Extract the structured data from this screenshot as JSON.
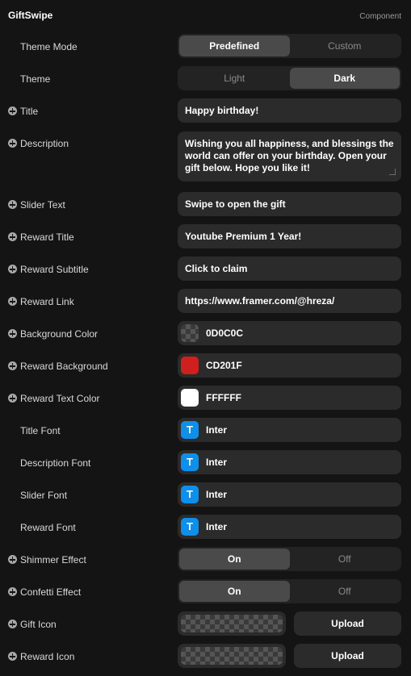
{
  "header": {
    "title": "GiftSwipe",
    "kind": "Component"
  },
  "theme_mode": {
    "label": "Theme Mode",
    "options": [
      "Predefined",
      "Custom"
    ],
    "selected": "Predefined"
  },
  "theme": {
    "label": "Theme",
    "options": [
      "Light",
      "Dark"
    ],
    "selected": "Dark"
  },
  "title": {
    "label": "Title",
    "value": "Happy birthday!"
  },
  "description": {
    "label": "Description",
    "lines": [
      "Wishing you all happiness, and blessings the",
      "world can offer on your birthday. Open your",
      "gift below. Hope you like it!"
    ]
  },
  "slider_text": {
    "label": "Slider Text",
    "value": "Swipe to open the gift"
  },
  "reward_title": {
    "label": "Reward Title",
    "value": "Youtube Premium 1 Year!"
  },
  "reward_subtitle": {
    "label": "Reward Subtitle",
    "value": "Click to claim"
  },
  "reward_link": {
    "label": "Reward Link",
    "value": "https://www.framer.com/@hreza/"
  },
  "background_color": {
    "label": "Background Color",
    "value": "0D0C0C",
    "color": "#0D0C0C"
  },
  "reward_background": {
    "label": "Reward Background",
    "value": "CD201F",
    "color": "#CD201F"
  },
  "reward_text_color": {
    "label": "Reward Text Color",
    "value": "FFFFFF",
    "color": "#FFFFFF"
  },
  "title_font": {
    "label": "Title Font",
    "icon": "T",
    "value": "Inter"
  },
  "description_font": {
    "label": "Description Font",
    "icon": "T",
    "value": "Inter"
  },
  "slider_font": {
    "label": "Slider Font",
    "icon": "T",
    "value": "Inter"
  },
  "reward_font": {
    "label": "Reward Font",
    "icon": "T",
    "value": "Inter"
  },
  "shimmer_effect": {
    "label": "Shimmer Effect",
    "options": [
      "On",
      "Off"
    ],
    "selected": "On"
  },
  "confetti_effect": {
    "label": "Confetti Effect",
    "options": [
      "On",
      "Off"
    ],
    "selected": "On"
  },
  "gift_icon": {
    "label": "Gift Icon",
    "button": "Upload"
  },
  "reward_icon": {
    "label": "Reward Icon",
    "button": "Upload"
  },
  "colors": {
    "accent": "#0E8FE9",
    "panel": "#141414",
    "control": "#2B2B2B"
  }
}
